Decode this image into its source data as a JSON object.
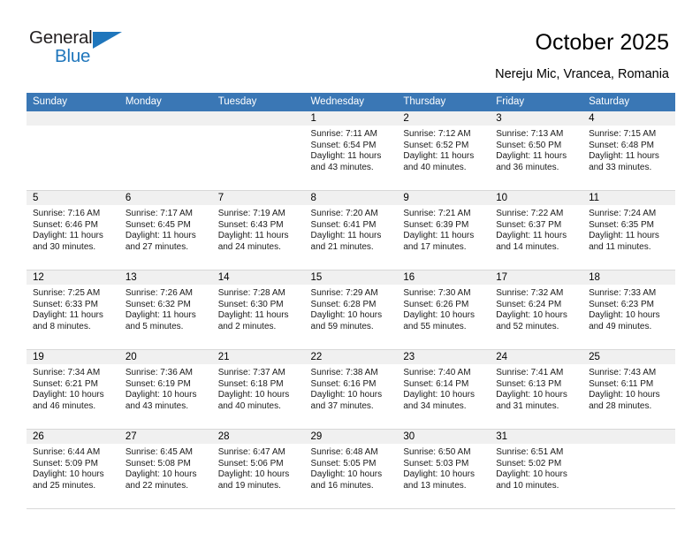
{
  "brand": {
    "word_one": "General",
    "word_two": "Blue",
    "accent_color": "#1f76bc"
  },
  "header": {
    "title": "October 2025",
    "subtitle": "Nereju Mic, Vrancea, Romania"
  },
  "calendar": {
    "header_bg": "#3a77b5",
    "daynum_bg": "#f0f0f0",
    "weekday_headers": [
      "Sunday",
      "Monday",
      "Tuesday",
      "Wednesday",
      "Thursday",
      "Friday",
      "Saturday"
    ],
    "labels": {
      "sunrise": "Sunrise:",
      "sunset": "Sunset:",
      "daylight": "Daylight:"
    },
    "weeks": [
      [
        {
          "day": "",
          "empty": true
        },
        {
          "day": "",
          "empty": true
        },
        {
          "day": "",
          "empty": true
        },
        {
          "day": "1",
          "sunrise": "Sunrise: 7:11 AM",
          "sunset": "Sunset: 6:54 PM",
          "daylight_1": "Daylight: 11 hours",
          "daylight_2": "and 43 minutes."
        },
        {
          "day": "2",
          "sunrise": "Sunrise: 7:12 AM",
          "sunset": "Sunset: 6:52 PM",
          "daylight_1": "Daylight: 11 hours",
          "daylight_2": "and 40 minutes."
        },
        {
          "day": "3",
          "sunrise": "Sunrise: 7:13 AM",
          "sunset": "Sunset: 6:50 PM",
          "daylight_1": "Daylight: 11 hours",
          "daylight_2": "and 36 minutes."
        },
        {
          "day": "4",
          "sunrise": "Sunrise: 7:15 AM",
          "sunset": "Sunset: 6:48 PM",
          "daylight_1": "Daylight: 11 hours",
          "daylight_2": "and 33 minutes."
        }
      ],
      [
        {
          "day": "5",
          "sunrise": "Sunrise: 7:16 AM",
          "sunset": "Sunset: 6:46 PM",
          "daylight_1": "Daylight: 11 hours",
          "daylight_2": "and 30 minutes."
        },
        {
          "day": "6",
          "sunrise": "Sunrise: 7:17 AM",
          "sunset": "Sunset: 6:45 PM",
          "daylight_1": "Daylight: 11 hours",
          "daylight_2": "and 27 minutes."
        },
        {
          "day": "7",
          "sunrise": "Sunrise: 7:19 AM",
          "sunset": "Sunset: 6:43 PM",
          "daylight_1": "Daylight: 11 hours",
          "daylight_2": "and 24 minutes."
        },
        {
          "day": "8",
          "sunrise": "Sunrise: 7:20 AM",
          "sunset": "Sunset: 6:41 PM",
          "daylight_1": "Daylight: 11 hours",
          "daylight_2": "and 21 minutes."
        },
        {
          "day": "9",
          "sunrise": "Sunrise: 7:21 AM",
          "sunset": "Sunset: 6:39 PM",
          "daylight_1": "Daylight: 11 hours",
          "daylight_2": "and 17 minutes."
        },
        {
          "day": "10",
          "sunrise": "Sunrise: 7:22 AM",
          "sunset": "Sunset: 6:37 PM",
          "daylight_1": "Daylight: 11 hours",
          "daylight_2": "and 14 minutes."
        },
        {
          "day": "11",
          "sunrise": "Sunrise: 7:24 AM",
          "sunset": "Sunset: 6:35 PM",
          "daylight_1": "Daylight: 11 hours",
          "daylight_2": "and 11 minutes."
        }
      ],
      [
        {
          "day": "12",
          "sunrise": "Sunrise: 7:25 AM",
          "sunset": "Sunset: 6:33 PM",
          "daylight_1": "Daylight: 11 hours",
          "daylight_2": "and 8 minutes."
        },
        {
          "day": "13",
          "sunrise": "Sunrise: 7:26 AM",
          "sunset": "Sunset: 6:32 PM",
          "daylight_1": "Daylight: 11 hours",
          "daylight_2": "and 5 minutes."
        },
        {
          "day": "14",
          "sunrise": "Sunrise: 7:28 AM",
          "sunset": "Sunset: 6:30 PM",
          "daylight_1": "Daylight: 11 hours",
          "daylight_2": "and 2 minutes."
        },
        {
          "day": "15",
          "sunrise": "Sunrise: 7:29 AM",
          "sunset": "Sunset: 6:28 PM",
          "daylight_1": "Daylight: 10 hours",
          "daylight_2": "and 59 minutes."
        },
        {
          "day": "16",
          "sunrise": "Sunrise: 7:30 AM",
          "sunset": "Sunset: 6:26 PM",
          "daylight_1": "Daylight: 10 hours",
          "daylight_2": "and 55 minutes."
        },
        {
          "day": "17",
          "sunrise": "Sunrise: 7:32 AM",
          "sunset": "Sunset: 6:24 PM",
          "daylight_1": "Daylight: 10 hours",
          "daylight_2": "and 52 minutes."
        },
        {
          "day": "18",
          "sunrise": "Sunrise: 7:33 AM",
          "sunset": "Sunset: 6:23 PM",
          "daylight_1": "Daylight: 10 hours",
          "daylight_2": "and 49 minutes."
        }
      ],
      [
        {
          "day": "19",
          "sunrise": "Sunrise: 7:34 AM",
          "sunset": "Sunset: 6:21 PM",
          "daylight_1": "Daylight: 10 hours",
          "daylight_2": "and 46 minutes."
        },
        {
          "day": "20",
          "sunrise": "Sunrise: 7:36 AM",
          "sunset": "Sunset: 6:19 PM",
          "daylight_1": "Daylight: 10 hours",
          "daylight_2": "and 43 minutes."
        },
        {
          "day": "21",
          "sunrise": "Sunrise: 7:37 AM",
          "sunset": "Sunset: 6:18 PM",
          "daylight_1": "Daylight: 10 hours",
          "daylight_2": "and 40 minutes."
        },
        {
          "day": "22",
          "sunrise": "Sunrise: 7:38 AM",
          "sunset": "Sunset: 6:16 PM",
          "daylight_1": "Daylight: 10 hours",
          "daylight_2": "and 37 minutes."
        },
        {
          "day": "23",
          "sunrise": "Sunrise: 7:40 AM",
          "sunset": "Sunset: 6:14 PM",
          "daylight_1": "Daylight: 10 hours",
          "daylight_2": "and 34 minutes."
        },
        {
          "day": "24",
          "sunrise": "Sunrise: 7:41 AM",
          "sunset": "Sunset: 6:13 PM",
          "daylight_1": "Daylight: 10 hours",
          "daylight_2": "and 31 minutes."
        },
        {
          "day": "25",
          "sunrise": "Sunrise: 7:43 AM",
          "sunset": "Sunset: 6:11 PM",
          "daylight_1": "Daylight: 10 hours",
          "daylight_2": "and 28 minutes."
        }
      ],
      [
        {
          "day": "26",
          "sunrise": "Sunrise: 6:44 AM",
          "sunset": "Sunset: 5:09 PM",
          "daylight_1": "Daylight: 10 hours",
          "daylight_2": "and 25 minutes."
        },
        {
          "day": "27",
          "sunrise": "Sunrise: 6:45 AM",
          "sunset": "Sunset: 5:08 PM",
          "daylight_1": "Daylight: 10 hours",
          "daylight_2": "and 22 minutes."
        },
        {
          "day": "28",
          "sunrise": "Sunrise: 6:47 AM",
          "sunset": "Sunset: 5:06 PM",
          "daylight_1": "Daylight: 10 hours",
          "daylight_2": "and 19 minutes."
        },
        {
          "day": "29",
          "sunrise": "Sunrise: 6:48 AM",
          "sunset": "Sunset: 5:05 PM",
          "daylight_1": "Daylight: 10 hours",
          "daylight_2": "and 16 minutes."
        },
        {
          "day": "30",
          "sunrise": "Sunrise: 6:50 AM",
          "sunset": "Sunset: 5:03 PM",
          "daylight_1": "Daylight: 10 hours",
          "daylight_2": "and 13 minutes."
        },
        {
          "day": "31",
          "sunrise": "Sunrise: 6:51 AM",
          "sunset": "Sunset: 5:02 PM",
          "daylight_1": "Daylight: 10 hours",
          "daylight_2": "and 10 minutes."
        },
        {
          "day": "",
          "empty": true
        }
      ]
    ]
  }
}
